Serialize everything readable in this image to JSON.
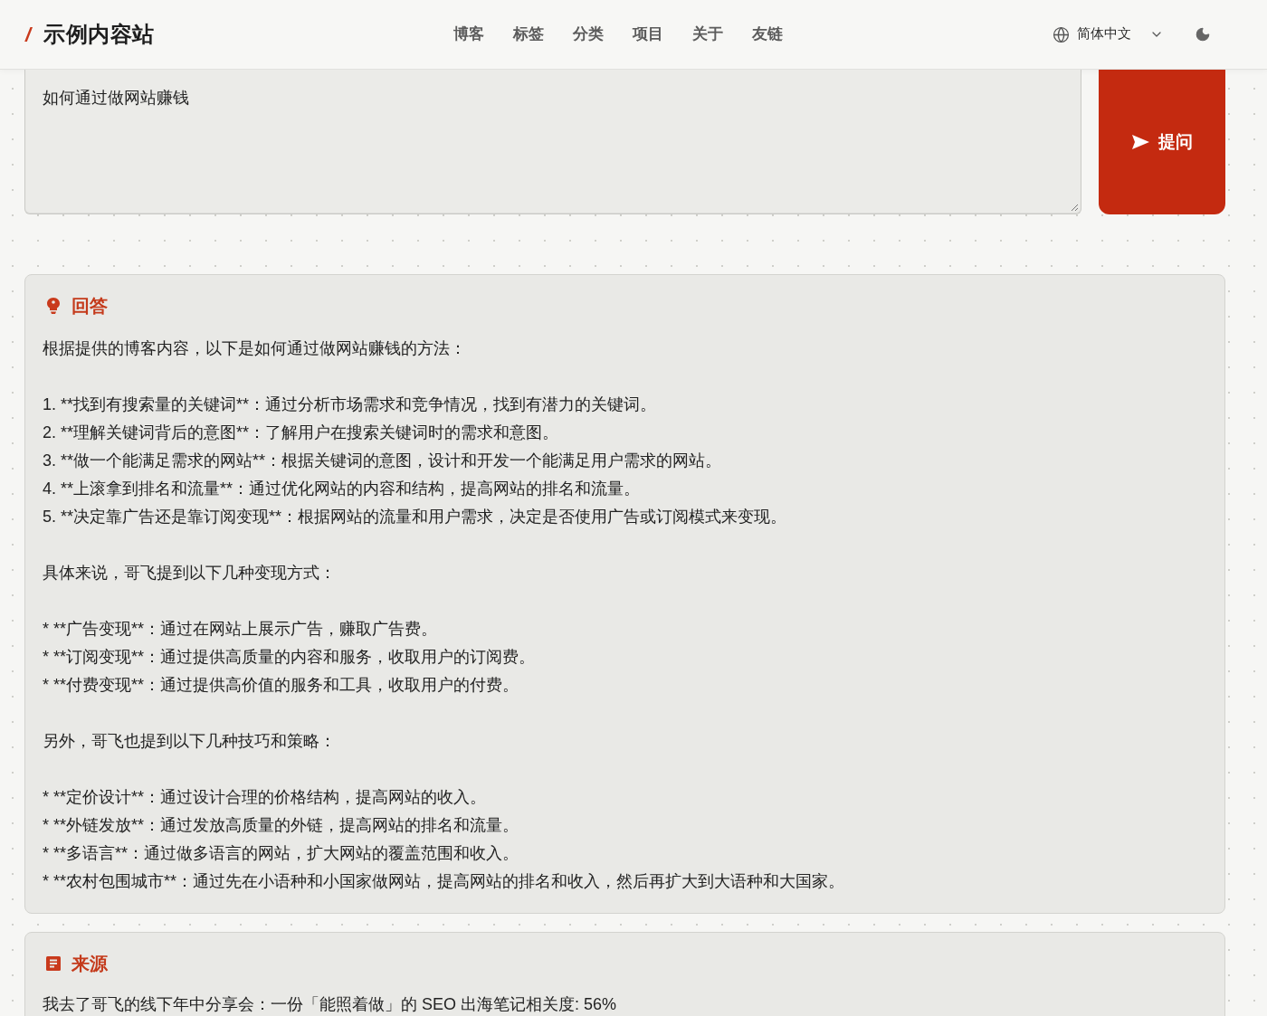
{
  "header": {
    "logo_mark": "/",
    "site_title": "示例内容站",
    "nav": [
      {
        "label": "博客"
      },
      {
        "label": "标签"
      },
      {
        "label": "分类"
      },
      {
        "label": "项目"
      },
      {
        "label": "关于"
      },
      {
        "label": "友链"
      }
    ],
    "language": "简体中文"
  },
  "question_field": {
    "value": "如何通过做网站赚钱"
  },
  "ask_button": {
    "label": "提问"
  },
  "answer": {
    "title": "回答",
    "paragraphs": [
      [
        "根据提供的博客内容，以下是如何通过做网站赚钱的方法："
      ],
      [
        "1. **找到有搜索量的关键词**：通过分析市场需求和竞争情况，找到有潜力的关键词。",
        "2. **理解关键词背后的意图**：了解用户在搜索关键词时的需求和意图。",
        "3. **做一个能满足需求的网站**：根据关键词的意图，设计和开发一个能满足用户需求的网站。",
        "4. **上滚拿到排名和流量**：通过优化网站的内容和结构，提高网站的排名和流量。",
        "5. **决定靠广告还是靠订阅变现**：根据网站的流量和用户需求，决定是否使用广告或订阅模式来变现。"
      ],
      [
        "具体来说，哥飞提到以下几种变现方式："
      ],
      [
        "* **广告变现**：通过在网站上展示广告，赚取广告费。",
        "* **订阅变现**：通过提供高质量的内容和服务，收取用户的订阅费。",
        "* **付费变现**：通过提供高价值的服务和工具，收取用户的付费。"
      ],
      [
        "另外，哥飞也提到以下几种技巧和策略："
      ],
      [
        "* **定价设计**：通过设计合理的价格结构，提高网站的收入。",
        "* **外链发放**：通过发放高质量的外链，提高网站的排名和流量。",
        "* **多语言**：通过做多语言的网站，扩大网站的覆盖范围和收入。",
        "* **农村包围城市**：通过先在小语种和小国家做网站，提高网站的排名和收入，然后再扩大到大语种和大国家。"
      ]
    ]
  },
  "sources": {
    "title": "来源",
    "items": [
      {
        "text": "我去了哥飞的线下年中分享会：一份「能照着做」的 SEO 出海笔记相关度: 56%"
      }
    ]
  }
}
